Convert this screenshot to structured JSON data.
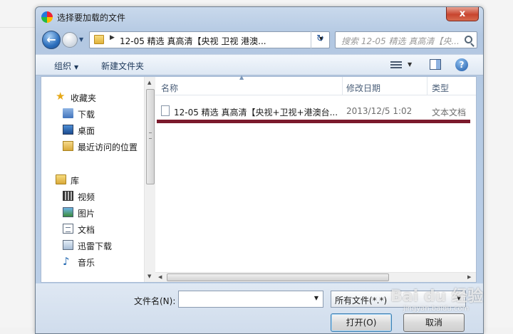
{
  "window": {
    "title": "选择要加载的文件",
    "close_label": "x"
  },
  "navbar": {
    "back_label": "←",
    "refresh_label": "↻",
    "address": "12-05 精选 真高清【央视 卫视 港澳...",
    "search_placeholder": "搜索 12-05 精选 真高清【央..."
  },
  "toolbar": {
    "organize": "组织",
    "new_folder": "新建文件夹",
    "help_label": "?"
  },
  "sidebar": {
    "favorites": "收藏夹",
    "items_fav": [
      "下载",
      "桌面",
      "最近访问的位置"
    ],
    "libraries": "库",
    "items_lib": [
      "视频",
      "图片",
      "文档",
      "迅雷下载",
      "音乐"
    ]
  },
  "file_list": {
    "columns": [
      "名称",
      "修改日期",
      "类型"
    ],
    "rows": [
      {
        "name": "12-05 精选 真高清【央视+卫视+港澳台...",
        "date": "2013/12/5 1:02",
        "type": "文本文档"
      }
    ]
  },
  "bottom": {
    "filename_label": "文件名(N):",
    "filename_value": "",
    "filetype": "所有文件(*.*)",
    "open_button": "打开(O)",
    "cancel_button": "取消"
  },
  "watermark": {
    "text": "Bai du 经验",
    "sub": "jingyan.baidu.com"
  },
  "colors": {
    "highlight_mark": "#7b1a2c",
    "close_button": "#c8452f",
    "accent": "#2c6fbd"
  }
}
